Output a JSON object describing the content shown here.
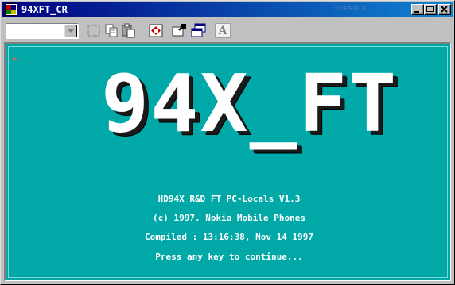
{
  "window": {
    "title": "94XFT_CR",
    "watermark": "ILLEGIBLE"
  },
  "toolbar": {
    "font_select_value": "",
    "tools": [
      "mark-icon",
      "copy-icon",
      "paste-icon",
      "fullscreen-icon",
      "properties-icon",
      "background-icon",
      "font-icon"
    ],
    "font_tool_glyph": "A"
  },
  "console": {
    "logo": "94X_FT",
    "lines": [
      "HD94X R&D FT PC-Locals V1.3",
      "(c) 1997. Nokia Mobile Phones",
      "Compiled : 13:16:38, Nov 14 1997",
      "Press any key to continue..."
    ],
    "background_color": "#00a8a8",
    "text_color": "#ffffff"
  }
}
